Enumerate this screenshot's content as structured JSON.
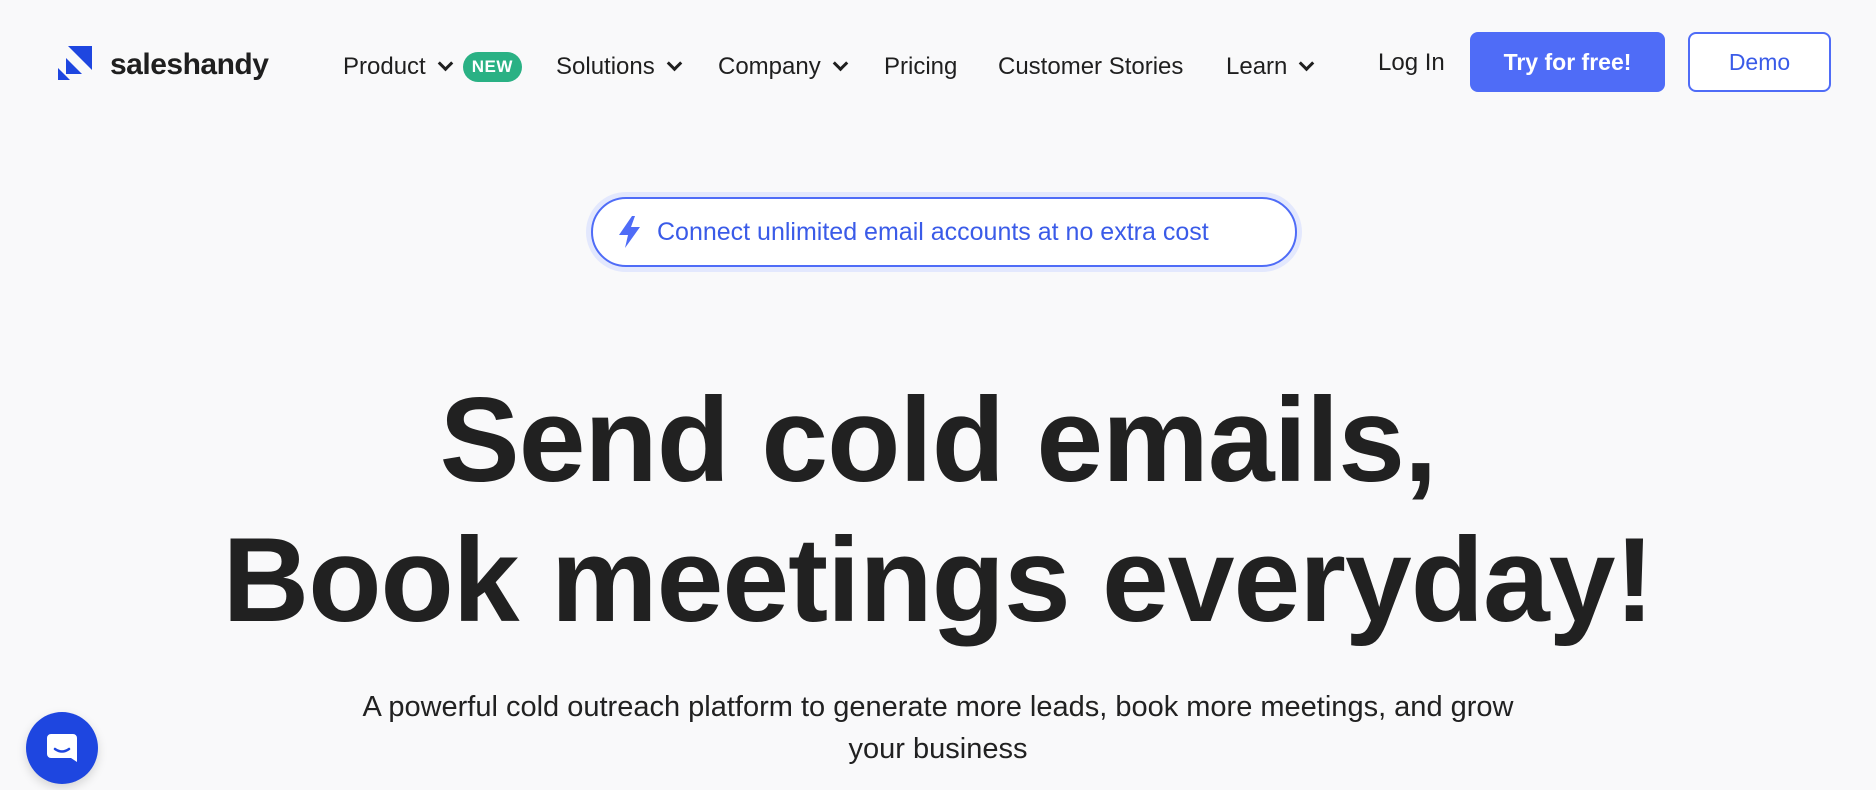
{
  "brand": {
    "name": "saleshandy",
    "accent_color": "#4f6cf7",
    "logo_color": "#1e46e0",
    "logo_icon": "saleshandy-logo-icon"
  },
  "nav": {
    "items": [
      {
        "label": "Product",
        "has_dropdown": true,
        "badge": "NEW"
      },
      {
        "label": "Solutions",
        "has_dropdown": true
      },
      {
        "label": "Company",
        "has_dropdown": true
      },
      {
        "label": "Pricing",
        "has_dropdown": false
      },
      {
        "label": "Customer Stories",
        "has_dropdown": false
      },
      {
        "label": "Learn",
        "has_dropdown": true
      }
    ],
    "login_label": "Log In",
    "try_label": "Try for free!",
    "demo_label": "Demo",
    "badge_color": "#2ab184"
  },
  "promo": {
    "icon": "lightning-bolt-icon",
    "text": "Connect unlimited email accounts at no extra cost"
  },
  "hero": {
    "line1": "Send cold emails,",
    "line2": "Book meetings everyday!",
    "subtitle": "A powerful cold outreach platform to generate more leads, book more meetings, and grow your business"
  },
  "chat": {
    "icon": "chat-bubble-icon"
  }
}
